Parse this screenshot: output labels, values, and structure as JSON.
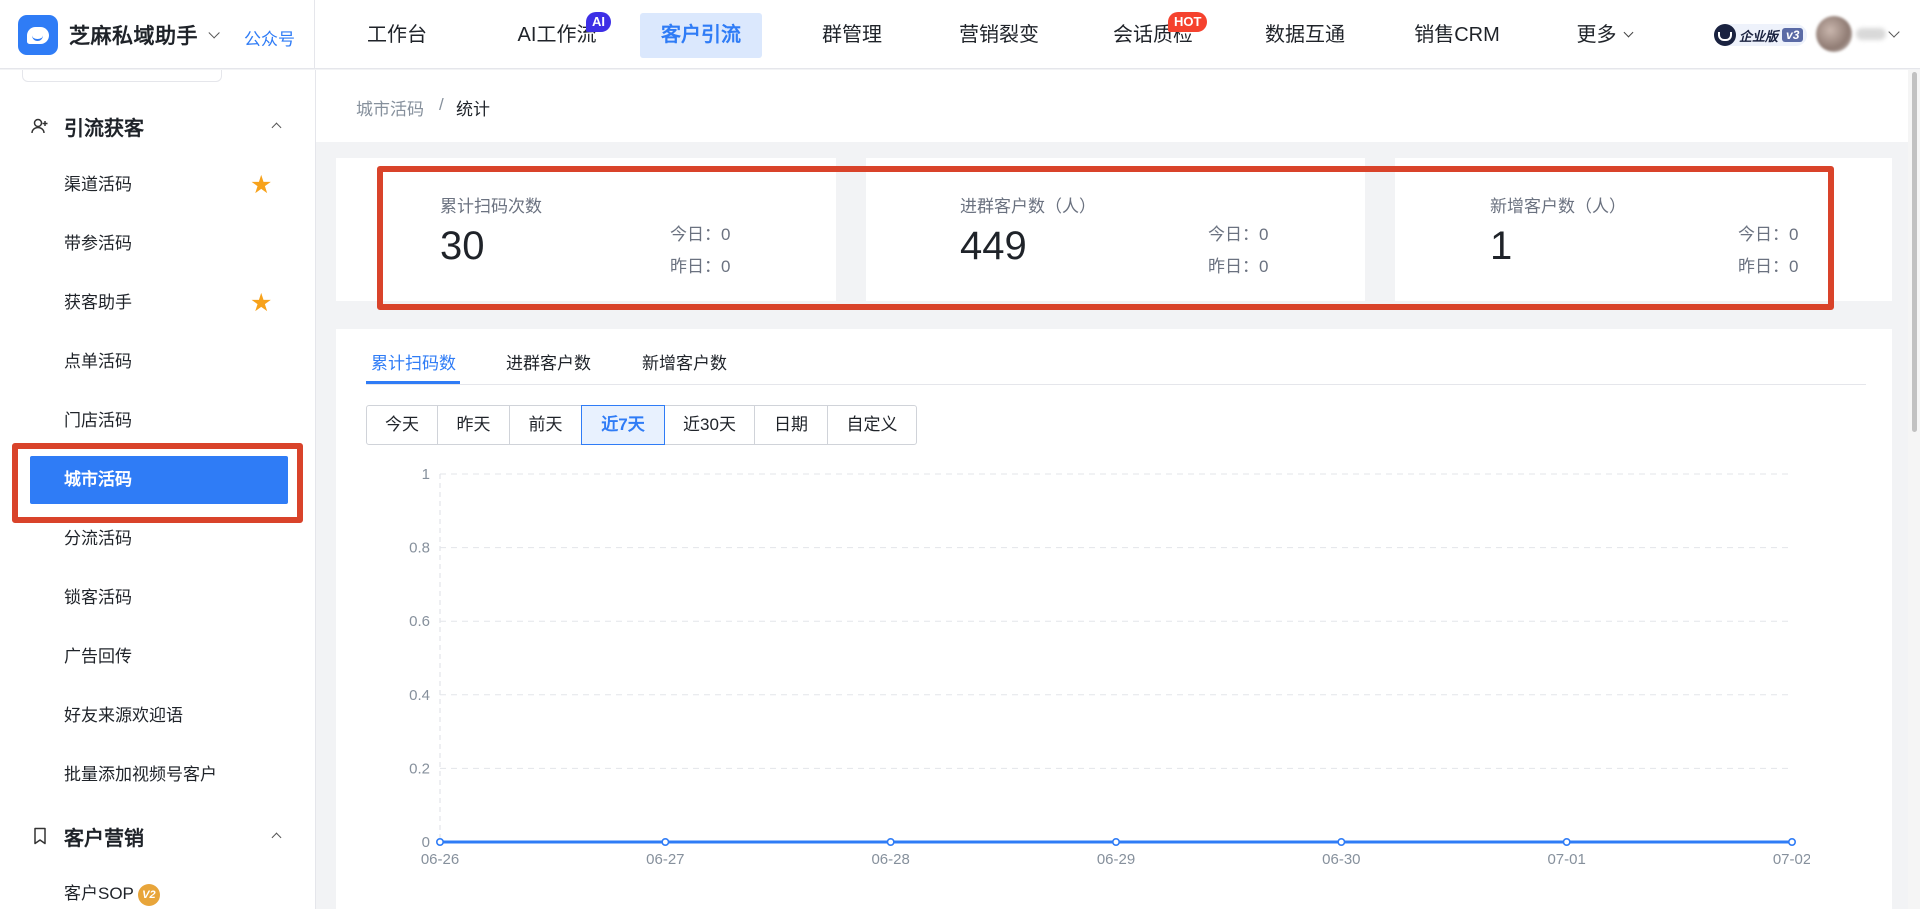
{
  "brand": {
    "name": "芝麻私域助手",
    "link": "公众号"
  },
  "nav": [
    {
      "label": "工作台"
    },
    {
      "label": "AI工作流",
      "badge": "AI"
    },
    {
      "label": "客户引流",
      "active": true
    },
    {
      "label": "群管理"
    },
    {
      "label": "营销裂变"
    },
    {
      "label": "会话质检",
      "badge": "HOT"
    },
    {
      "label": "数据互通"
    },
    {
      "label": "销售CRM"
    },
    {
      "label": "更多"
    }
  ],
  "edition": {
    "label": "企业版",
    "version": "v3"
  },
  "sidebar": {
    "groups": [
      {
        "label": "引流获客"
      },
      {
        "label": "客户营销"
      }
    ],
    "items": [
      {
        "label": "渠道活码",
        "starred": true
      },
      {
        "label": "带参活码"
      },
      {
        "label": "获客助手",
        "starred": true
      },
      {
        "label": "点单活码"
      },
      {
        "label": "门店活码"
      },
      {
        "label": "城市活码",
        "active": true
      },
      {
        "label": "分流活码"
      },
      {
        "label": "锁客活码"
      },
      {
        "label": "广告回传"
      },
      {
        "label": "好友来源欢迎语"
      },
      {
        "label": "批量添加视频号客户"
      }
    ],
    "marketing_items": [
      {
        "label": "客户SOP",
        "badge": "V2"
      }
    ]
  },
  "breadcrumb": {
    "parent": "城市活码",
    "separator": "/",
    "current": "统计"
  },
  "stats": [
    {
      "label": "累计扫码次数",
      "value": "30",
      "today_label": "今日：",
      "today": "0",
      "yesterday_label": "昨日：",
      "yesterday": "0"
    },
    {
      "label": "进群客户数（人）",
      "value": "449",
      "today_label": "今日：",
      "today": "0",
      "yesterday_label": "昨日：",
      "yesterday": "0"
    },
    {
      "label": "新增客户数（人）",
      "value": "1",
      "today_label": "今日：",
      "today": "0",
      "yesterday_label": "昨日：",
      "yesterday": "0"
    }
  ],
  "tabs": [
    {
      "label": "累计扫码数",
      "active": true
    },
    {
      "label": "进群客户数"
    },
    {
      "label": "新增客户数"
    }
  ],
  "ranges": [
    {
      "label": "今天"
    },
    {
      "label": "昨天"
    },
    {
      "label": "前天"
    },
    {
      "label": "近7天",
      "active": true
    },
    {
      "label": "近30天"
    },
    {
      "label": "日期"
    },
    {
      "label": "自定义"
    }
  ],
  "colors": {
    "accent": "#2f7cf6",
    "highlight": "#d9432a",
    "star": "#f7a21b",
    "hot": "#f5422e",
    "ai": "#3d2fe6"
  },
  "chart_data": {
    "type": "line",
    "categories": [
      "06-26",
      "06-27",
      "06-28",
      "06-29",
      "06-30",
      "07-01",
      "07-02"
    ],
    "series": [
      {
        "values": [
          0,
          0,
          0,
          0,
          0,
          0,
          0
        ]
      }
    ],
    "yticks": [
      "0",
      "0.2",
      "0.4",
      "0.6",
      "0.8",
      "1"
    ],
    "ylim": [
      0,
      1
    ],
    "grid": true
  }
}
